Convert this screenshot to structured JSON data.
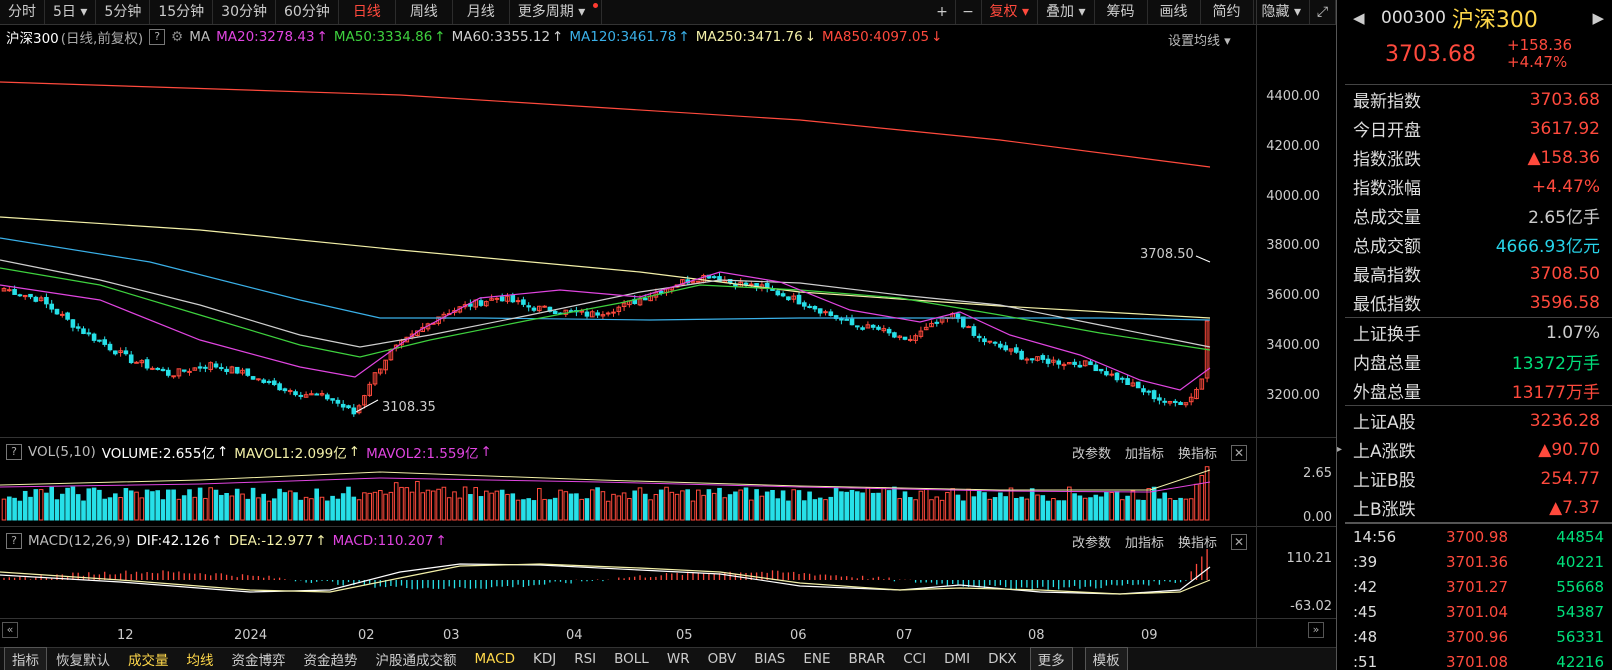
{
  "toolbar": {
    "tabs": [
      "分时",
      "5日",
      "5分钟",
      "15分钟",
      "30分钟",
      "60分钟",
      "日线",
      "周线",
      "月线",
      "更多周期"
    ],
    "active": "日线",
    "right": [
      "复权",
      "叠加",
      "筹码",
      "画线",
      "简约",
      "隐藏"
    ]
  },
  "ma_bar": {
    "name": "沪深300",
    "mode": "(日线,前复权)",
    "ma": "MA",
    "ma20": "MA20:3278.43",
    "ma50": "MA50:3334.86",
    "ma60": "MA60:3355.12",
    "ma120": "MA120:3461.78",
    "ma250": "MA250:3471.76",
    "ma850": "MA850:4097.05",
    "settings": "设置均线"
  },
  "colors": {
    "ma20": "#e045e0",
    "ma50": "#3ed13e",
    "ma60": "#cfcfcf",
    "ma120": "#3ab0e8",
    "ma250": "#f3f0a8",
    "ma850": "#ff4a3d",
    "up": "#ff4a3d",
    "down": "#27e0e8"
  },
  "price_axis": [
    "4400.00",
    "4200.00",
    "4000.00",
    "3800.00",
    "3600.00",
    "3400.00",
    "3200.00"
  ],
  "annotations": {
    "high": "3708.50",
    "low": "3108.35"
  },
  "vol_panel": {
    "name": "VOL(5,10)",
    "volume": "VOLUME:2.655亿",
    "mavol1": "MAVOL1:2.099亿",
    "mavol2": "MAVOL2:1.559亿",
    "axis": [
      "2.65",
      "0.00"
    ]
  },
  "macd_panel": {
    "name": "MACD(12,26,9)",
    "dif": "DIF:42.126",
    "dea": "DEA:-12.977",
    "macd": "MACD:110.207",
    "axis": [
      "110.21",
      "-63.02"
    ]
  },
  "panel_btns": [
    "改参数",
    "加指标",
    "换指标"
  ],
  "dates": [
    "12",
    "2024",
    "02",
    "03",
    "04",
    "05",
    "06",
    "07",
    "08",
    "09"
  ],
  "bottom_tabs": [
    "指标",
    "恢复默认",
    "成交量",
    "均线",
    "资金博弈",
    "资金趋势",
    "沪股通成交额",
    "MACD",
    "KDJ",
    "RSI",
    "BOLL",
    "WR",
    "OBV",
    "BIAS",
    "ENE",
    "BRAR",
    "CCI",
    "DMI",
    "DKX",
    "更多",
    "模板"
  ],
  "side": {
    "code": "000300",
    "name": "沪深300",
    "price": "3703.68",
    "change": "+158.36",
    "pct": "+4.47%",
    "rows1": [
      [
        "最新指数",
        "3703.68"
      ],
      [
        "今日开盘",
        "3617.92"
      ],
      [
        "指数涨跌",
        "▲158.36"
      ],
      [
        "指数涨幅",
        "+4.47%"
      ],
      [
        "总成交量",
        "2.65亿手"
      ],
      [
        "总成交额",
        "4666.93亿元"
      ],
      [
        "最高指数",
        "3708.50"
      ],
      [
        "最低指数",
        "3596.58"
      ]
    ],
    "rows2": [
      [
        "上证换手",
        "1.07%"
      ],
      [
        "内盘总量",
        "13372万手"
      ],
      [
        "外盘总量",
        "13177万手"
      ]
    ],
    "rows3": [
      [
        "上证A股",
        "3236.28"
      ],
      [
        "上A涨跌",
        "▲90.70"
      ],
      [
        "上证B股",
        "254.77"
      ],
      [
        "上B涨跌",
        "▲7.37"
      ]
    ],
    "ticks": [
      [
        "14:56",
        "3700.98",
        "44854"
      ],
      [
        ":39",
        "3701.36",
        "40221"
      ],
      [
        ":42",
        "3701.27",
        "55668"
      ],
      [
        ":45",
        "3701.04",
        "54387"
      ],
      [
        ":48",
        "3700.96",
        "56331"
      ],
      [
        ":51",
        "3701.08",
        "42216"
      ]
    ]
  }
}
